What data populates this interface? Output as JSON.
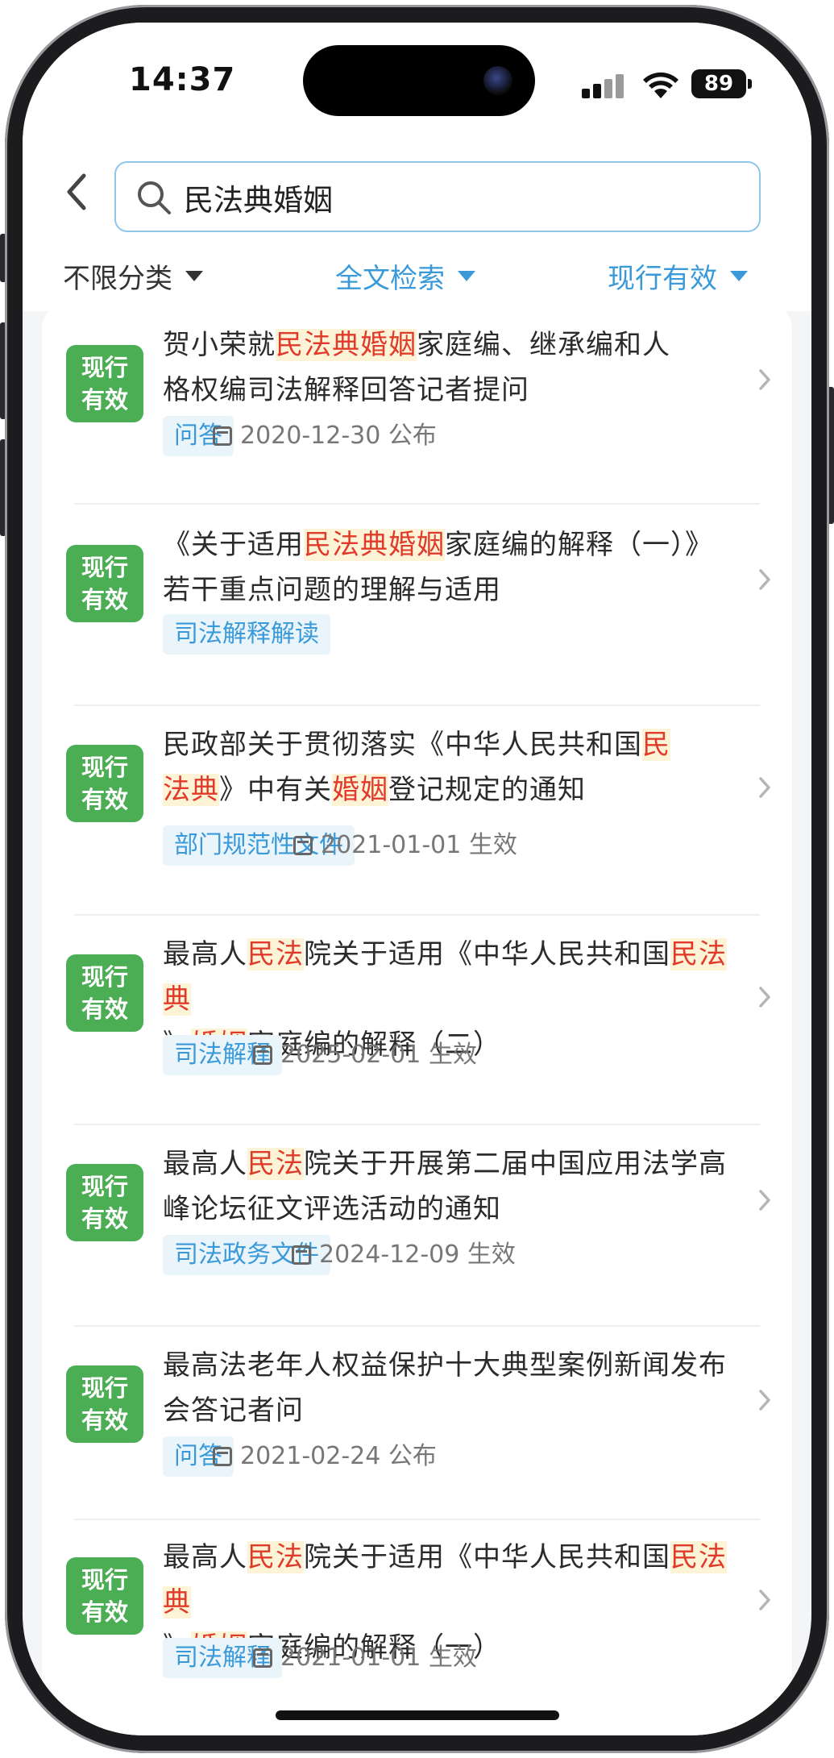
{
  "status_bar": {
    "time": "14:37",
    "battery": "89"
  },
  "search": {
    "value": "民法典婚姻"
  },
  "filters": [
    {
      "label": "不限分类"
    },
    {
      "label": "全文检索"
    },
    {
      "label": "现行有效"
    }
  ],
  "colors": {
    "accent": "#3a9ad9",
    "badge": "#4cae54",
    "highlight": "#e03b2a",
    "highlight_bg": "#fdf4d8"
  },
  "results": [
    {
      "badge": [
        "现行",
        "有效"
      ],
      "title_parts": [
        [
          "贺小荣就",
          false
        ],
        [
          "民法典婚姻",
          true
        ],
        [
          "家庭编、继承编和人",
          false
        ],
        [
          "格权编司法解释回答记者提问",
          false
        ]
      ],
      "tag": "问答",
      "date": "2020-12-30 公布"
    },
    {
      "badge": [
        "现行",
        "有效"
      ],
      "title_parts": [
        [
          "《关于适用",
          false
        ],
        [
          "民法典婚姻",
          true
        ],
        [
          "家庭编的解释",
          false
        ],
        [
          "（一）》若干重点问题的理解与适用",
          false
        ]
      ],
      "tag": "司法解释解读",
      "date": ""
    },
    {
      "badge": [
        "现行",
        "有效"
      ],
      "title_parts": [
        [
          "民政部关于贯彻落实《中华人民共和国",
          false
        ],
        [
          "民",
          true
        ],
        [
          "法典",
          true
        ],
        [
          "》中有关",
          false
        ],
        [
          "婚姻",
          true
        ],
        [
          "登记规定的通知",
          false
        ]
      ],
      "tag": "部门规范性文件",
      "date": "2021-01-01 生效"
    },
    {
      "badge": [
        "现行",
        "有效"
      ],
      "title_parts": [
        [
          "最高人",
          false
        ],
        [
          "民法",
          true
        ],
        [
          "院关于适用《中华人民共和国",
          false
        ],
        [
          "民法典",
          true
        ],
        [
          "》",
          false
        ],
        [
          "婚姻",
          true
        ],
        [
          "家庭编的解释（二）",
          false
        ]
      ],
      "tag": "司法解释",
      "date": "2025-02-01 生效"
    },
    {
      "badge": [
        "现行",
        "有效"
      ],
      "title_parts": [
        [
          "最高人",
          false
        ],
        [
          "民法",
          true
        ],
        [
          "院关于开展第二届中国应用法",
          false
        ],
        [
          "学高峰论坛征文评选活动的通知",
          false
        ]
      ],
      "tag": "司法政务文件",
      "date": "2024-12-09 生效"
    },
    {
      "badge": [
        "现行",
        "有效"
      ],
      "title_parts": [
        [
          "最高法老年人权益保护十大典型案例新闻发",
          false
        ],
        [
          "布会答记者问",
          false
        ]
      ],
      "tag": "问答",
      "date": "2021-02-24 公布"
    },
    {
      "badge": [
        "现行",
        "有效"
      ],
      "title_parts": [
        [
          "最高人",
          false
        ],
        [
          "民法",
          true
        ],
        [
          "院关于适用《中华人民共和国",
          false
        ],
        [
          "民法典",
          true
        ],
        [
          "》",
          false
        ],
        [
          "婚姻",
          true
        ],
        [
          "家庭编的解释（一）",
          false
        ]
      ],
      "tag": "司法解释",
      "date": "2021-01-01 生效"
    }
  ]
}
